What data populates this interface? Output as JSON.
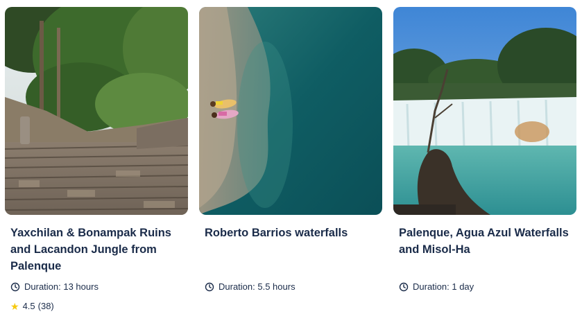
{
  "cards": [
    {
      "title": "Yaxchilan & Bonampak Ruins and Lacandon Jungle from Palenque",
      "duration": "Duration: 13 hours",
      "rating": "4.5",
      "reviews": "(38)",
      "image_icon": "ruins-jungle-photo"
    },
    {
      "title": "Roberto Barrios waterfalls",
      "duration": "Duration: 5.5 hours",
      "image_icon": "turquoise-water-photo"
    },
    {
      "title": "Palenque, Agua Azul Waterfalls and Misol-Ha",
      "duration": "Duration: 1 day",
      "image_icon": "waterfall-photo"
    }
  ],
  "colors": {
    "text": "#1a2b49",
    "star": "#f6c90e"
  }
}
